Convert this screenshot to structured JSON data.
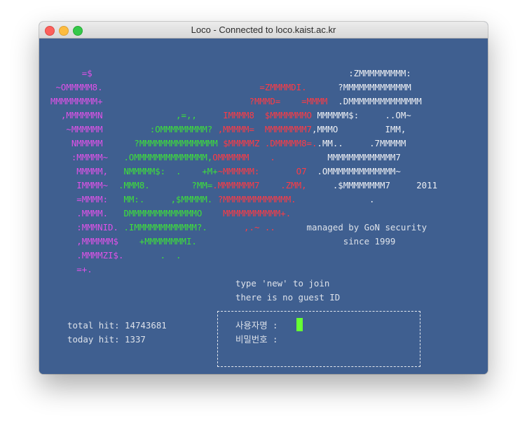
{
  "window": {
    "title": "Loco - Connected to loco.kaist.ac.kr"
  },
  "palette": {
    "background": "#3f5f90",
    "magenta": "#e052e8",
    "red": "#ff3b44",
    "green": "#3ee03a",
    "white": "#eef0f4",
    "cursor": "#66ff33"
  },
  "art": {
    "lines": [
      [
        [
          "m",
          "      =$"
        ],
        [
          "w",
          "                                                 :ZMMMMMMMMM:"
        ]
      ],
      [
        [
          "m",
          " ~OMMMMM8."
        ],
        [
          "r",
          "                              =ZMMMMDI."
        ],
        [
          "w",
          "      ?MMMMMMMMMMMMM"
        ]
      ],
      [
        [
          "m",
          "MMMMMMMMM+"
        ],
        [
          "r",
          "                            ?MMMD=    =MMMM"
        ],
        [
          "w",
          "  .DMMMMMMMMMMMMMM"
        ]
      ],
      [
        [
          "m",
          "  ,MMMMMMN"
        ],
        [
          "g",
          "              ,=,,"
        ],
        [
          "r",
          "     IMMMM8  $MMMMMMMO"
        ],
        [
          "w",
          " MMMMMM$:     ..OM~"
        ]
      ],
      [
        [
          "m",
          "   ~MMMMMM"
        ],
        [
          "g",
          "         :OMMMMMMMMM?"
        ],
        [
          "r",
          " ,MMMMM=  MMMMMMMM7"
        ],
        [
          "w",
          ",MMMO         IMM,"
        ]
      ],
      [
        [
          "m",
          "    NMMMMM"
        ],
        [
          "g",
          "      ?MMMMMMMMMMMMMMM"
        ],
        [
          "r",
          " $MMMMMZ .DMMMMM8=."
        ],
        [
          "w",
          ".MM..     .7MMMMM"
        ]
      ],
      [
        [
          "m",
          "    :MMMMM~"
        ],
        [
          "g",
          "   .OMMMMMMMMMMMMMM,"
        ],
        [
          "r",
          "OMMMMMM    ."
        ],
        [
          "w",
          "          MMMMMMMMMMMMM7"
        ]
      ],
      [
        [
          "m",
          "     MMMMM,"
        ],
        [
          "g",
          "   NMMMMM$:  .    +M+"
        ],
        [
          "r",
          "~MMMMMM:       O7"
        ],
        [
          "w",
          "  .OMMMMMMMMMMMMM~"
        ]
      ],
      [
        [
          "m",
          "     IMMMM~"
        ],
        [
          "g",
          "  .MMM8.        ?MM="
        ],
        [
          "r",
          ".MMMMMMM7    .ZMM,"
        ],
        [
          "w",
          "     .$MMMMMMMM7     2011"
        ]
      ],
      [
        [
          "m",
          "     =MMMM:"
        ],
        [
          "g",
          "   MM:.     ,$MMMMM."
        ],
        [
          "r",
          " ?MMMMMMMMMMMMM."
        ],
        [
          "w",
          "              ."
        ]
      ],
      [
        [
          "m",
          "     .MMMM."
        ],
        [
          "g",
          "   DMMMMMMMMMMMMMO"
        ],
        [
          "r",
          "    MMMMMMMMMMM+."
        ]
      ],
      [
        [
          "m",
          "     :MMMNID."
        ],
        [
          "g",
          " .IMMMMMMMMMMMM?."
        ],
        [
          "r",
          "       ,.~ .."
        ],
        [
          "t",
          "      managed by GoN security"
        ]
      ],
      [
        [
          "m",
          "     ,MMMMMM$"
        ],
        [
          "g",
          "    +MMMMMMMMI."
        ],
        [
          "t",
          "                            since 1999"
        ]
      ],
      [
        [
          "m",
          "     .MMMMZI$."
        ],
        [
          "g",
          "       .  ."
        ]
      ],
      [
        [
          "m",
          "     =+."
        ]
      ]
    ]
  },
  "join_text": {
    "line1": "type 'new' to join",
    "line2": "there is no guest ID"
  },
  "stats": {
    "total": "total hit: 14743681",
    "today": "today hit: 1337"
  },
  "login": {
    "username_label": "사용자명 :",
    "password_label": "비밀번호 :"
  }
}
